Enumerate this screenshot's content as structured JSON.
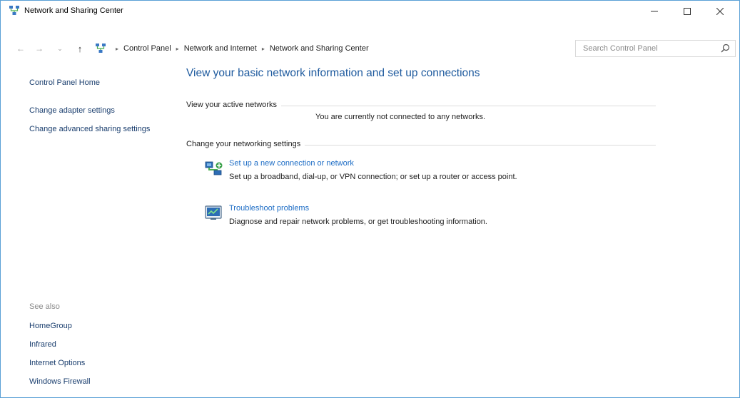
{
  "window": {
    "title": "Network and Sharing Center",
    "accent_border": "#5aa0d6"
  },
  "titlebar_buttons": {
    "minimize": "—",
    "maximize": "☐",
    "close": "✕"
  },
  "nav": {
    "back": "←",
    "forward": "→",
    "recent": "⌄",
    "up": "↑",
    "crumb_sep": "▸",
    "breadcrumbs": [
      "Control Panel",
      "Network and Internet",
      "Network and Sharing Center"
    ],
    "dropdown": "⌄",
    "refresh": "↻"
  },
  "search": {
    "placeholder": "Search Control Panel"
  },
  "sidebar": {
    "home": "Control Panel Home",
    "adapter": "Change adapter settings",
    "advanced": "Change advanced sharing settings",
    "see_also": "See also",
    "see_also_links": [
      "HomeGroup",
      "Infrared",
      "Internet Options",
      "Windows Firewall"
    ]
  },
  "main": {
    "title": "View your basic network information and set up connections",
    "active_networks_header": "View your active networks",
    "no_network": "You are currently not connected to any networks.",
    "change_settings_header": "Change your networking settings",
    "tasks": [
      {
        "link": "Set up a new connection or network",
        "desc": "Set up a broadband, dial-up, or VPN connection; or set up a router or access point.",
        "icon": "network-setup-icon"
      },
      {
        "link": "Troubleshoot problems",
        "desc": "Diagnose and repair network problems, or get troubleshooting information.",
        "icon": "troubleshoot-icon"
      }
    ]
  },
  "colors": {
    "link_blue": "#1c6cc5",
    "title_blue": "#1e5a9e",
    "sidebar_link": "#1a3e6e",
    "muted": "#8a8a8a"
  }
}
